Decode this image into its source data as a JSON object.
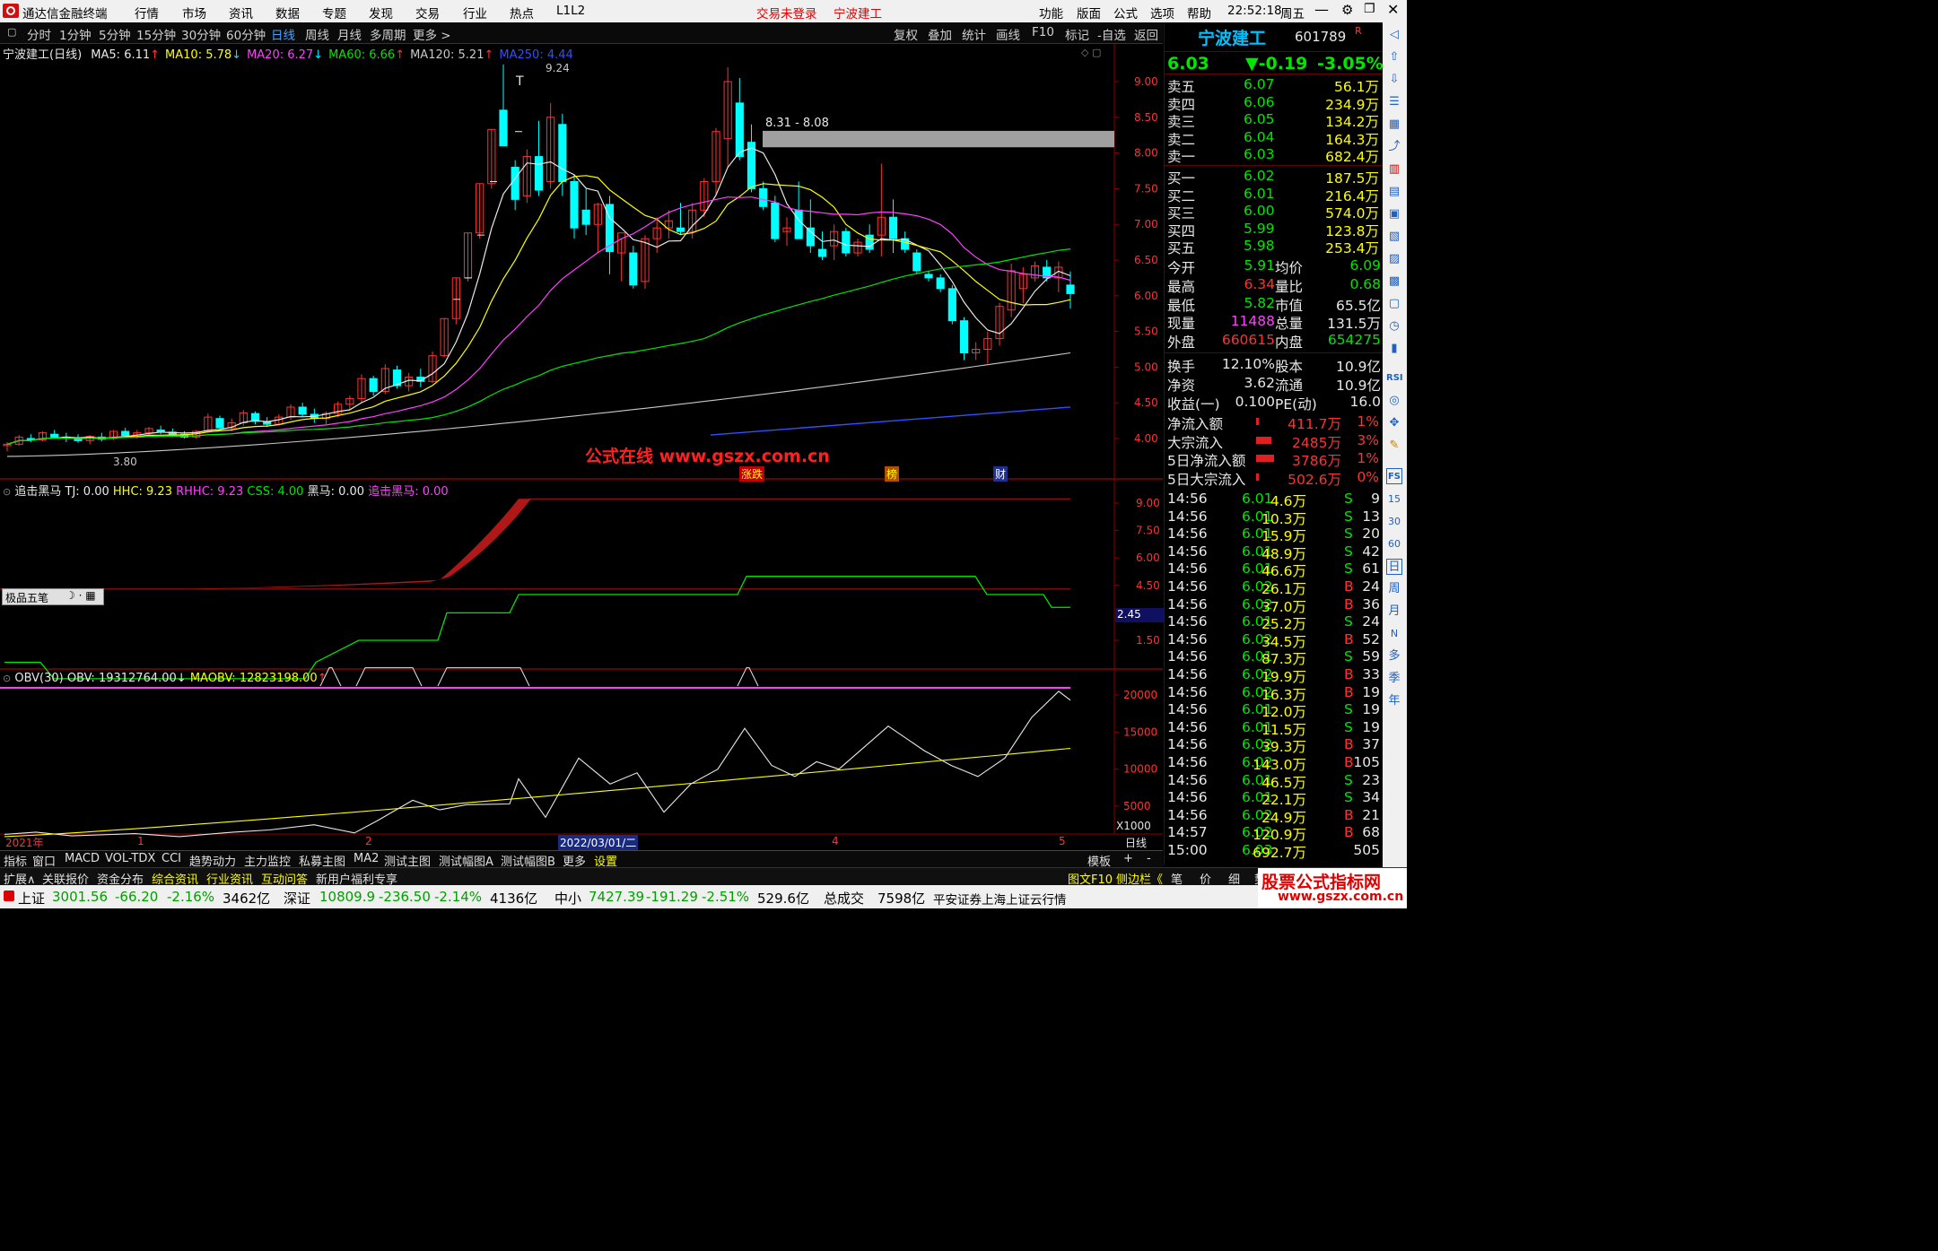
{
  "titlebar": {
    "app_name": "通达信金融终端",
    "menu": [
      "行情",
      "市场",
      "资讯",
      "数据",
      "专题",
      "发现",
      "交易",
      "行业",
      "热点",
      "L1L2"
    ],
    "login_status": "交易未登录",
    "stock_name": "宁波建工",
    "right_menu": [
      "功能",
      "版面",
      "公式",
      "选项",
      "帮助"
    ],
    "time": "22:52:18",
    "weekday": "周五"
  },
  "periodbar": {
    "periods": [
      "分时",
      "1分钟",
      "5分钟",
      "15分钟",
      "30分钟",
      "60分钟",
      "日线",
      "周线",
      "月线",
      "多周期",
      "更多 >"
    ],
    "active": "日线",
    "tools": [
      "复权",
      "叠加",
      "统计",
      "画线",
      "F10",
      "标记",
      "-自选",
      "返回"
    ]
  },
  "main_chart": {
    "title": "宁波建工(日线)",
    "ma_labels": [
      {
        "text": "MA5: 6.11",
        "arrow": "↑",
        "color": "#e8e8e8"
      },
      {
        "text": "MA10: 5.78",
        "arrow": "↓",
        "color": "#ffff00"
      },
      {
        "text": "MA20: 6.27",
        "arrow": "↓",
        "color": "#ff40ff"
      },
      {
        "text": "MA60: 6.66",
        "arrow": "↑",
        "color": "#00e600"
      },
      {
        "text": "MA120: 5.21",
        "arrow": "↑",
        "color": "#c8c8c8"
      },
      {
        "text": "MA250: 4.44",
        "arrow": "",
        "color": "#3050ff"
      }
    ],
    "y_ticks": [
      "9.00",
      "8.50",
      "8.00",
      "7.50",
      "7.00",
      "6.50",
      "6.00",
      "5.50",
      "5.00",
      "4.50",
      "4.00"
    ],
    "high_label": "9.24",
    "low_label": "3.80",
    "gap_label": "8.31 - 8.08",
    "watermark": "公式在线  www.gszx.com.cn",
    "event_markers": [
      "涨跌",
      "榜",
      "财"
    ]
  },
  "indicator1": {
    "name": "追击黑马",
    "values": "TJ: 0.00",
    "hhc": "HHC: 9.23",
    "rhhc": "RHHC: 9.23",
    "css": "CSS: 4.00",
    "heima": "黑马: 0.00",
    "zhuiji": "追击黑马: 0.00",
    "y_ticks": [
      "9.00",
      "7.50",
      "6.00",
      "4.50",
      "1.50"
    ],
    "current_tag": "2.45",
    "pen_tool": "极品五笔"
  },
  "indicator2": {
    "name": "OBV(30)",
    "obv": "OBV: 19312764.00",
    "maobv": "MAOBV: 12823198.00",
    "y_ticks": [
      "20000",
      "15000",
      "10000",
      "5000"
    ],
    "unit": "X1000"
  },
  "xaxis": {
    "labels": [
      "2021年",
      "1",
      "2",
      "2022/03/01/二",
      "4",
      "5"
    ],
    "period": "日线"
  },
  "chart_data": {
    "type": "candlestick",
    "title": "宁波建工(日线)",
    "ylim": [
      3.6,
      9.5
    ],
    "ohlc": [
      [
        3.9,
        3.95,
        3.82,
        3.92
      ],
      [
        3.92,
        4.05,
        3.9,
        4.02
      ],
      [
        4.0,
        4.06,
        3.95,
        3.98
      ],
      [
        3.98,
        4.1,
        3.96,
        4.08
      ],
      [
        4.06,
        4.12,
        4.0,
        4.02
      ],
      [
        4.02,
        4.08,
        3.95,
        4.0
      ],
      [
        4.0,
        4.06,
        3.94,
        3.97
      ],
      [
        3.97,
        4.05,
        3.92,
        4.03
      ],
      [
        4.02,
        4.08,
        3.96,
        3.99
      ],
      [
        4.0,
        4.12,
        3.98,
        4.1
      ],
      [
        4.1,
        4.15,
        4.02,
        4.04
      ],
      [
        4.05,
        4.12,
        4.0,
        4.08
      ],
      [
        4.08,
        4.16,
        4.05,
        4.14
      ],
      [
        4.12,
        4.18,
        4.06,
        4.09
      ],
      [
        4.09,
        4.14,
        4.02,
        4.06
      ],
      [
        4.06,
        4.1,
        4.0,
        4.02
      ],
      [
        4.02,
        4.12,
        4.0,
        4.1
      ],
      [
        4.1,
        4.35,
        4.08,
        4.3
      ],
      [
        4.28,
        4.32,
        4.12,
        4.15
      ],
      [
        4.15,
        4.28,
        4.1,
        4.22
      ],
      [
        4.22,
        4.4,
        4.18,
        4.36
      ],
      [
        4.35,
        4.38,
        4.2,
        4.24
      ],
      [
        4.24,
        4.3,
        4.16,
        4.2
      ],
      [
        4.2,
        4.34,
        4.18,
        4.3
      ],
      [
        4.3,
        4.48,
        4.26,
        4.44
      ],
      [
        4.44,
        4.5,
        4.3,
        4.34
      ],
      [
        4.34,
        4.42,
        4.22,
        4.28
      ],
      [
        4.28,
        4.38,
        4.2,
        4.35
      ],
      [
        4.35,
        4.52,
        4.3,
        4.48
      ],
      [
        4.48,
        4.6,
        4.4,
        4.56
      ],
      [
        4.56,
        4.9,
        4.5,
        4.84
      ],
      [
        4.84,
        4.88,
        4.6,
        4.66
      ],
      [
        4.66,
        5.04,
        4.62,
        4.98
      ],
      [
        4.96,
        5.02,
        4.7,
        4.74
      ],
      [
        4.74,
        4.92,
        4.66,
        4.86
      ],
      [
        4.86,
        4.98,
        4.72,
        4.8
      ],
      [
        4.8,
        5.22,
        4.78,
        5.16
      ],
      [
        5.16,
        5.68,
        5.14,
        5.68
      ],
      [
        5.68,
        6.25,
        5.6,
        6.25
      ],
      [
        6.25,
        6.88,
        6.2,
        6.88
      ],
      [
        6.88,
        7.57,
        6.8,
        7.57
      ],
      [
        7.57,
        8.33,
        7.5,
        8.33
      ],
      [
        8.6,
        9.24,
        8.1,
        8.1
      ],
      [
        7.8,
        7.9,
        7.2,
        7.35
      ],
      [
        7.4,
        8.05,
        7.3,
        7.95
      ],
      [
        7.95,
        8.45,
        7.4,
        7.48
      ],
      [
        7.6,
        8.7,
        7.5,
        8.5
      ],
      [
        8.4,
        8.55,
        7.4,
        7.6
      ],
      [
        7.6,
        7.7,
        6.8,
        6.95
      ],
      [
        7.2,
        7.5,
        6.85,
        7.0
      ],
      [
        7.0,
        7.3,
        6.6,
        7.28
      ],
      [
        7.28,
        7.4,
        6.3,
        6.62
      ],
      [
        6.6,
        6.8,
        6.2,
        6.88
      ],
      [
        6.6,
        6.7,
        6.1,
        6.15
      ],
      [
        6.2,
        6.85,
        6.1,
        6.8
      ],
      [
        6.8,
        7.1,
        6.6,
        6.95
      ],
      [
        6.95,
        7.2,
        6.8,
        7.05
      ],
      [
        6.95,
        7.3,
        6.85,
        6.9
      ],
      [
        6.9,
        7.3,
        6.8,
        7.2
      ],
      [
        7.2,
        7.65,
        7.1,
        7.6
      ],
      [
        7.6,
        8.35,
        7.4,
        8.3
      ],
      [
        8.2,
        9.2,
        7.8,
        9.0
      ],
      [
        8.7,
        9.05,
        7.9,
        7.95
      ],
      [
        8.15,
        8.4,
        7.45,
        7.5
      ],
      [
        7.5,
        7.6,
        7.2,
        7.25
      ],
      [
        7.3,
        7.4,
        6.75,
        6.8
      ],
      [
        6.9,
        7.1,
        6.7,
        6.95
      ],
      [
        7.2,
        7.6,
        6.8,
        6.8
      ],
      [
        6.95,
        7.35,
        6.6,
        6.7
      ],
      [
        6.65,
        6.9,
        6.5,
        6.55
      ],
      [
        6.7,
        7.0,
        6.5,
        6.9
      ],
      [
        6.9,
        6.95,
        6.55,
        6.6
      ],
      [
        6.6,
        6.8,
        6.55,
        6.75
      ],
      [
        6.85,
        7.0,
        6.6,
        6.65
      ],
      [
        6.85,
        7.85,
        6.55,
        7.1
      ],
      [
        7.1,
        7.35,
        6.6,
        6.8
      ],
      [
        6.8,
        6.9,
        6.6,
        6.65
      ],
      [
        6.6,
        6.65,
        6.3,
        6.35
      ],
      [
        6.3,
        6.35,
        6.2,
        6.25
      ],
      [
        6.25,
        6.3,
        6.05,
        6.1
      ],
      [
        6.1,
        6.15,
        5.6,
        5.65
      ],
      [
        5.65,
        5.7,
        5.1,
        5.2
      ],
      [
        5.2,
        5.35,
        5.1,
        5.25
      ],
      [
        5.25,
        5.5,
        5.05,
        5.4
      ],
      [
        5.4,
        5.9,
        5.3,
        5.85
      ],
      [
        5.8,
        6.45,
        5.7,
        6.35
      ],
      [
        6.1,
        6.4,
        5.9,
        6.3
      ],
      [
        6.25,
        6.48,
        6.2,
        6.42
      ],
      [
        6.4,
        6.5,
        6.2,
        6.25
      ],
      [
        6.25,
        6.48,
        6.05,
        6.4
      ],
      [
        6.15,
        6.34,
        5.82,
        6.03
      ]
    ],
    "series": [
      {
        "name": "MA5",
        "color": "#e8e8e8"
      },
      {
        "name": "MA10",
        "color": "#ffff00"
      },
      {
        "name": "MA20",
        "color": "#ff40ff"
      },
      {
        "name": "MA60",
        "color": "#00e600"
      },
      {
        "name": "MA120",
        "color": "#c8c8c8"
      },
      {
        "name": "MA250",
        "color": "#3050ff"
      }
    ],
    "obv_ylim": [
      0,
      22000
    ],
    "ind_ylim": [
      0,
      10
    ]
  },
  "quote": {
    "name": "宁波建工",
    "code": "601789",
    "suffix": "R",
    "price": "6.03",
    "change": "▼-0.19",
    "pct": "-3.05%",
    "asks": [
      {
        "label": "卖五",
        "price": "6.07",
        "vol": "56.1万"
      },
      {
        "label": "卖四",
        "price": "6.06",
        "vol": "234.9万"
      },
      {
        "label": "卖三",
        "price": "6.05",
        "vol": "134.2万"
      },
      {
        "label": "卖二",
        "price": "6.04",
        "vol": "164.3万"
      },
      {
        "label": "卖一",
        "price": "6.03",
        "vol": "682.4万"
      }
    ],
    "bids": [
      {
        "label": "买一",
        "price": "6.02",
        "vol": "187.5万"
      },
      {
        "label": "买二",
        "price": "6.01",
        "vol": "216.4万"
      },
      {
        "label": "买三",
        "price": "6.00",
        "vol": "574.0万"
      },
      {
        "label": "买四",
        "price": "5.99",
        "vol": "123.8万"
      },
      {
        "label": "买五",
        "price": "5.98",
        "vol": "253.4万"
      }
    ],
    "stats": [
      {
        "l1": "今开",
        "v1": "5.91",
        "c1": "#00e600",
        "l2": "均价",
        "v2": "6.09",
        "c2": "#00e600"
      },
      {
        "l1": "最高",
        "v1": "6.34",
        "c1": "#ff3232",
        "l2": "量比",
        "v2": "0.68",
        "c2": "#00e600"
      },
      {
        "l1": "最低",
        "v1": "5.82",
        "c1": "#00e600",
        "l2": "市值",
        "v2": "65.5亿",
        "c2": "#e8e8e8"
      },
      {
        "l1": "现量",
        "v1": "11488",
        "c1": "#ff40ff",
        "l2": "总量",
        "v2": "131.5万",
        "c2": "#e8e8e8"
      },
      {
        "l1": "外盘",
        "v1": "660615",
        "c1": "#ff3232",
        "l2": "内盘",
        "v2": "654275",
        "c2": "#00e600"
      }
    ],
    "stats2": [
      {
        "l1": "换手",
        "v1": "12.10%",
        "l2": "股本",
        "v2": "10.9亿"
      },
      {
        "l1": "净资",
        "v1": "3.62",
        "l2": "流通",
        "v2": "10.9亿"
      },
      {
        "l1": "收益(一)",
        "v1": "0.100",
        "l2": "PE(动)",
        "v2": "16.0"
      }
    ],
    "flows": [
      {
        "label": "净流入额",
        "val": "411.7万",
        "pct": "1%",
        "bar": 0.05
      },
      {
        "label": "大宗流入",
        "val": "2485万",
        "pct": "3%",
        "bar": 0.6
      },
      {
        "label": "5日净流入额",
        "val": "3786万",
        "pct": "1%",
        "bar": 0.7
      },
      {
        "label": "5日大宗流入",
        "val": "502.6万",
        "pct": "0%",
        "bar": 0.1
      }
    ],
    "ticks": [
      [
        "14:56",
        "6.01",
        "4.6万",
        "S",
        "9"
      ],
      [
        "14:56",
        "6.01",
        "10.3万",
        "S",
        "13"
      ],
      [
        "14:56",
        "6.01",
        "15.9万",
        "S",
        "20"
      ],
      [
        "14:56",
        "6.01",
        "48.9万",
        "S",
        "42"
      ],
      [
        "14:56",
        "6.01",
        "46.6万",
        "S",
        "61"
      ],
      [
        "14:56",
        "6.02",
        "26.1万",
        "B",
        "24"
      ],
      [
        "14:56",
        "6.02",
        "37.0万",
        "B",
        "36"
      ],
      [
        "14:56",
        "6.01",
        "25.2万",
        "S",
        "24"
      ],
      [
        "14:56",
        "6.02",
        "34.5万",
        "B",
        "52"
      ],
      [
        "14:56",
        "6.01",
        "87.3万",
        "S",
        "59"
      ],
      [
        "14:56",
        "6.02",
        "19.9万",
        "B",
        "33"
      ],
      [
        "14:56",
        "6.02",
        "16.3万",
        "B",
        "19"
      ],
      [
        "14:56",
        "6.01",
        "12.0万",
        "S",
        "19"
      ],
      [
        "14:56",
        "6.01",
        "11.5万",
        "S",
        "19"
      ],
      [
        "14:56",
        "6.02",
        "39.3万",
        "B",
        "37"
      ],
      [
        "14:56",
        "6.02",
        "143.0万",
        "B",
        "105"
      ],
      [
        "14:56",
        "6.01",
        "46.5万",
        "S",
        "23"
      ],
      [
        "14:56",
        "6.01",
        "22.1万",
        "S",
        "34"
      ],
      [
        "14:56",
        "6.02",
        "24.9万",
        "B",
        "21"
      ],
      [
        "14:57",
        "6.02",
        "120.9万",
        "B",
        "68"
      ],
      [
        "15:00",
        "6.03",
        "692.7万",
        "",
        "505"
      ]
    ]
  },
  "sidetools": {
    "labels": [
      "RSI",
      "FS",
      "15",
      "30",
      "60",
      "日",
      "周",
      "月",
      "N",
      "多",
      "季",
      "年"
    ]
  },
  "tabs1": [
    "指标",
    "窗口",
    "MACD",
    "VOL-TDX",
    "CCI",
    "趋势动力",
    "主力监控",
    "私募主图",
    "MA2",
    "测试主图",
    "测试幅图A",
    "测试幅图B",
    "更多",
    "设置"
  ],
  "tabs1_right": [
    "模板",
    "+",
    "-"
  ],
  "tabs2": [
    {
      "text": "扩展∧",
      "color": "#e0e0e0"
    },
    {
      "text": "关联报价",
      "color": "#e0e0e0"
    },
    {
      "text": "资金分布",
      "color": "#e0e0e0"
    },
    {
      "text": "综合资讯",
      "color": "#ffff00"
    },
    {
      "text": "行业资讯",
      "color": "#ffff00"
    },
    {
      "text": "互动问答",
      "color": "#ffff00"
    },
    {
      "text": "新用户福利专享",
      "color": "#e0e0e0"
    }
  ],
  "tabs2_right": [
    "图文F10",
    "侧边栏《",
    "笔",
    "价",
    "细",
    "势"
  ],
  "statusbar": {
    "items": [
      {
        "name": "上证",
        "value": "3001.56",
        "chg": "-66.20",
        "pct": "-2.16%",
        "amt": "3462亿"
      },
      {
        "name": "深证",
        "value": "10809.9",
        "chg": "-236.50",
        "pct": "-2.14%",
        "amt": "4136亿"
      },
      {
        "name": "中小",
        "value": "7427.39",
        "chg": "-191.29",
        "pct": "-2.51%",
        "amt": "529.6亿"
      }
    ],
    "total_label": "总成交",
    "total_value": "7598亿",
    "broker": "平安证券上海上证云行情"
  },
  "corner_watermark": {
    "title": "股票公式指标网",
    "url": "www.gszx.com.cn"
  }
}
